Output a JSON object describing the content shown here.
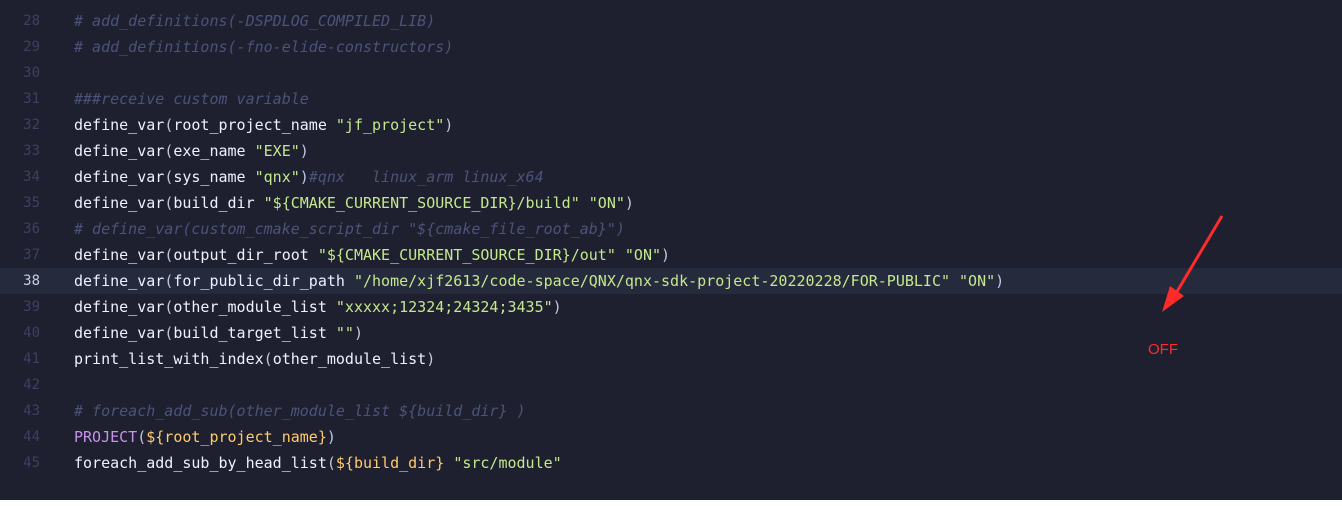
{
  "editor": {
    "lines": [
      {
        "num": "28",
        "tokens": [
          {
            "t": "comment",
            "v": "# add_definitions(-DSPDLOG_COMPILED_LIB)"
          }
        ]
      },
      {
        "num": "29",
        "tokens": [
          {
            "t": "comment",
            "v": "# add_definitions(-fno-elide-constructors)"
          }
        ]
      },
      {
        "num": "30",
        "tokens": []
      },
      {
        "num": "31",
        "tokens": [
          {
            "t": "comment",
            "v": "###receive custom variable"
          }
        ]
      },
      {
        "num": "32",
        "tokens": [
          {
            "t": "fn",
            "v": "define_var"
          },
          {
            "t": "paren",
            "v": "("
          },
          {
            "t": "arg",
            "v": "root_project_name "
          },
          {
            "t": "str",
            "v": "\"jf_project\""
          },
          {
            "t": "paren",
            "v": ")"
          }
        ]
      },
      {
        "num": "33",
        "tokens": [
          {
            "t": "fn",
            "v": "define_var"
          },
          {
            "t": "paren",
            "v": "("
          },
          {
            "t": "arg",
            "v": "exe_name "
          },
          {
            "t": "str",
            "v": "\"EXE\""
          },
          {
            "t": "paren",
            "v": ")"
          }
        ]
      },
      {
        "num": "34",
        "tokens": [
          {
            "t": "fn",
            "v": "define_var"
          },
          {
            "t": "paren",
            "v": "("
          },
          {
            "t": "arg",
            "v": "sys_name "
          },
          {
            "t": "str",
            "v": "\"qnx\""
          },
          {
            "t": "paren",
            "v": ")"
          },
          {
            "t": "comment",
            "v": "#qnx   linux_arm linux_x64"
          }
        ]
      },
      {
        "num": "35",
        "tokens": [
          {
            "t": "fn",
            "v": "define_var"
          },
          {
            "t": "paren",
            "v": "("
          },
          {
            "t": "arg",
            "v": "build_dir "
          },
          {
            "t": "str",
            "v": "\"${CMAKE_CURRENT_SOURCE_DIR}/build\" \"ON\""
          },
          {
            "t": "paren",
            "v": ")"
          }
        ]
      },
      {
        "num": "36",
        "tokens": [
          {
            "t": "comment",
            "v": "# define_var(custom_cmake_script_dir \"${cmake_file_root_ab}\")"
          }
        ]
      },
      {
        "num": "37",
        "tokens": [
          {
            "t": "fn",
            "v": "define_var"
          },
          {
            "t": "paren",
            "v": "("
          },
          {
            "t": "arg",
            "v": "output_dir_root "
          },
          {
            "t": "str",
            "v": "\"${CMAKE_CURRENT_SOURCE_DIR}/out\" \"ON\""
          },
          {
            "t": "paren",
            "v": ")"
          }
        ]
      },
      {
        "num": "38",
        "current": true,
        "tokens": [
          {
            "t": "fn",
            "v": "define_var"
          },
          {
            "t": "paren",
            "v": "("
          },
          {
            "t": "arg",
            "v": "for_public_dir_path "
          },
          {
            "t": "str",
            "v": "\"/home/xjf2613/code-space/QNX/qnx-sdk-project-20220228/FOR-PUBLIC\" \"ON\""
          },
          {
            "t": "paren",
            "v": ")"
          }
        ]
      },
      {
        "num": "39",
        "tokens": [
          {
            "t": "fn",
            "v": "define_var"
          },
          {
            "t": "paren",
            "v": "("
          },
          {
            "t": "arg",
            "v": "other_module_list "
          },
          {
            "t": "str",
            "v": "\"xxxxx;12324;24324;3435\""
          },
          {
            "t": "paren",
            "v": ")"
          }
        ]
      },
      {
        "num": "40",
        "tokens": [
          {
            "t": "fn",
            "v": "define_var"
          },
          {
            "t": "paren",
            "v": "("
          },
          {
            "t": "arg",
            "v": "build_target_list "
          },
          {
            "t": "str",
            "v": "\"\""
          },
          {
            "t": "paren",
            "v": ")"
          }
        ]
      },
      {
        "num": "41",
        "tokens": [
          {
            "t": "fn",
            "v": "print_list_with_index"
          },
          {
            "t": "paren",
            "v": "("
          },
          {
            "t": "arg",
            "v": "other_module_list"
          },
          {
            "t": "paren",
            "v": ")"
          }
        ]
      },
      {
        "num": "42",
        "tokens": []
      },
      {
        "num": "43",
        "tokens": [
          {
            "t": "comment",
            "v": "# foreach_add_sub(other_module_list ${build_dir} )"
          }
        ]
      },
      {
        "num": "44",
        "tokens": [
          {
            "t": "kw",
            "v": "PROJECT"
          },
          {
            "t": "paren",
            "v": "("
          },
          {
            "t": "var",
            "v": "${root_project_name}"
          },
          {
            "t": "paren",
            "v": ")"
          }
        ]
      },
      {
        "num": "45",
        "tokens": [
          {
            "t": "fn",
            "v": "foreach_add_sub_by_head_list"
          },
          {
            "t": "paren",
            "v": "("
          },
          {
            "t": "var",
            "v": "${build_dir}"
          },
          {
            "t": "arg",
            "v": " "
          },
          {
            "t": "str",
            "v": "\"src/module\""
          }
        ]
      }
    ]
  },
  "annotation": {
    "label": "OFF",
    "color": "#ff2a2a"
  },
  "colors": {
    "background": "#1e2030",
    "comment": "#4c5378",
    "string": "#c3e88d",
    "keyword": "#c792ea",
    "variable": "#ffcb6b"
  }
}
